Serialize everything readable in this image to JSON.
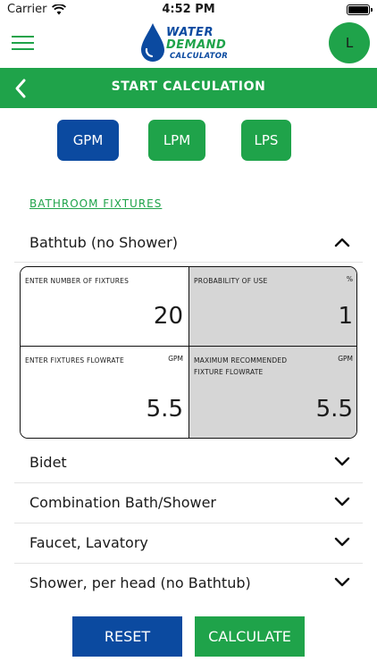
{
  "status_bar": {
    "carrier": "Carrier",
    "time": "4:52 PM"
  },
  "header": {
    "logo_line1": "WATER",
    "logo_line2": "DEMAND",
    "logo_line3": "CALCULATOR",
    "avatar_initial": "L",
    "menu_icon": "hamburger-icon"
  },
  "title_bar": {
    "title": "START  CALCULATION",
    "back_icon": "chevron-left-icon"
  },
  "units": {
    "gpm": "GPM",
    "lpm": "LPM",
    "lps": "LPS",
    "selected": "GPM"
  },
  "section_title": "BATHROOM FIXTURES",
  "expanded_fixture": {
    "label": "Bathtub (no Shower)",
    "fields": {
      "num_fixtures_label": "ENTER NUMBER OF FIXTURES",
      "num_fixtures_value": "20",
      "probability_label": "PROBABILITY OF USE",
      "probability_unit": "%",
      "probability_value": "1",
      "flowrate_label": "ENTER FIXTURES FLOWRATE",
      "flowrate_unit": "GPM",
      "flowrate_value": "5.5",
      "max_flowrate_label": "MAXIMUM RECOMMENDED FIXTURE FLOWRATE",
      "max_flowrate_unit": "GPM",
      "max_flowrate_value": "5.5"
    }
  },
  "fixtures": [
    {
      "label": "Bidet"
    },
    {
      "label": "Combination Bath/Shower"
    },
    {
      "label": "Faucet, Lavatory"
    },
    {
      "label": "Shower, per head (no Bathtub)"
    }
  ],
  "actions": {
    "reset": "RESET",
    "calculate": "CALCULATE"
  },
  "colors": {
    "green": "#1fa34a",
    "blue": "#0b4aa0",
    "readonly_gray": "#d6d6d6"
  }
}
